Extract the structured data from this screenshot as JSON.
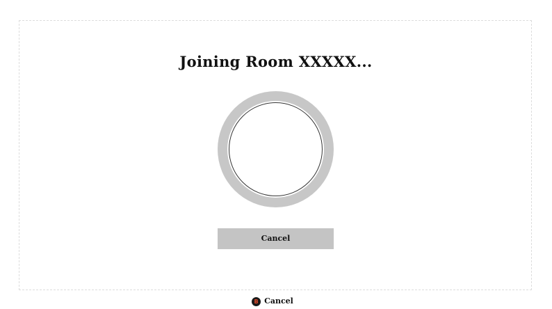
{
  "screen": {
    "title": "Joining Room XXXXX..."
  },
  "spinner": {
    "icon": "loading-spinner-icon",
    "ring_color": "#c7c7c7"
  },
  "buttons": {
    "cancel_label": "Cancel",
    "cancel_bg": "#c4c4c4"
  },
  "hint_bar": {
    "button_glyph": "B",
    "button_icon": "b-button-icon",
    "button_color": "#e04a2a",
    "action_label": "Cancel"
  }
}
